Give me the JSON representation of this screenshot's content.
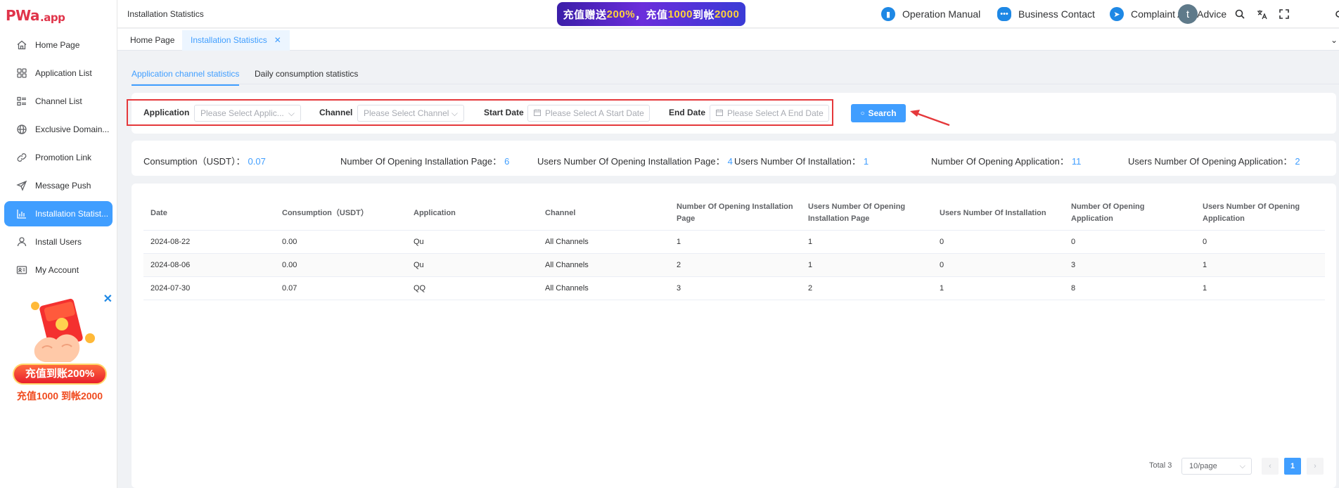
{
  "logo": {
    "main": "PWa",
    "suffix": ".app"
  },
  "sidebar": {
    "items": [
      {
        "label": "Home Page",
        "icon": "home-icon"
      },
      {
        "label": "Application List",
        "icon": "grid-icon"
      },
      {
        "label": "Channel List",
        "icon": "list-icon"
      },
      {
        "label": "Exclusive Domain...",
        "icon": "globe-icon"
      },
      {
        "label": "Promotion Link",
        "icon": "link-icon"
      },
      {
        "label": "Message Push",
        "icon": "send-icon"
      },
      {
        "label": "Installation Statist...",
        "icon": "bar-chart-icon",
        "active": true
      },
      {
        "label": "Install Users",
        "icon": "user-icon"
      },
      {
        "label": "My Account",
        "icon": "account-card-icon"
      }
    ]
  },
  "promo": {
    "line1": "充值到账200%",
    "line2": "充值1000 到帐2000"
  },
  "header": {
    "crumb": "Installation Statistics",
    "banner_a": "充值赠送",
    "banner_b": "200%",
    "banner_c": "，充值",
    "banner_d": "1000",
    "banner_e": "到帐",
    "banner_f": "2000",
    "operation_manual": "Operation Manual",
    "business_contact": "Business Contact",
    "complaint_advice": "Complaint And Advice",
    "avatar_letter": "t"
  },
  "tabs": [
    {
      "label": "Home Page"
    },
    {
      "label": "Installation Statistics",
      "active": true
    }
  ],
  "sub_tabs": [
    {
      "label": "Application channel statistics",
      "active": true
    },
    {
      "label": "Daily consumption statistics"
    }
  ],
  "filters": {
    "application_label": "Application",
    "application_placeholder": "Please Select Applic...",
    "channel_label": "Channel",
    "channel_placeholder": "Please Select Channel",
    "start_label": "Start Date",
    "start_placeholder": "Please Select A Start Date",
    "end_label": "End Date",
    "end_placeholder": "Please Select A End Date",
    "search_button": "Search"
  },
  "stats": [
    {
      "label": "Consumption（USDT）：",
      "value": "0.07"
    },
    {
      "label": "Number Of Opening Installation Page：",
      "value": "6"
    },
    {
      "label": "Users Number Of Opening Installation Page：",
      "value": "4"
    },
    {
      "label": "Users Number Of Installation：",
      "value": "1"
    },
    {
      "label": "Number Of Opening Application：",
      "value": "11"
    },
    {
      "label": "Users Number Of Opening Application：",
      "value": "2"
    }
  ],
  "table": {
    "columns": [
      "Date",
      "Consumption（USDT）",
      "Application",
      "Channel",
      "Number Of Opening Installation Page",
      "Users Number Of Opening Installation Page",
      "Users Number Of Installation",
      "Number Of Opening Application",
      "Users Number Of Opening Application"
    ],
    "rows": [
      [
        "2024-08-22",
        "0.00",
        "Qu",
        "All Channels",
        "1",
        "1",
        "0",
        "0",
        "0"
      ],
      [
        "2024-08-06",
        "0.00",
        "Qu",
        "All Channels",
        "2",
        "1",
        "0",
        "3",
        "1"
      ],
      [
        "2024-07-30",
        "0.07",
        "QQ",
        "All Channels",
        "3",
        "2",
        "1",
        "8",
        "1"
      ]
    ]
  },
  "pagination": {
    "total": "Total 3",
    "page_size": "10/page",
    "current_page": "1",
    "prev": "‹",
    "next": "›"
  }
}
